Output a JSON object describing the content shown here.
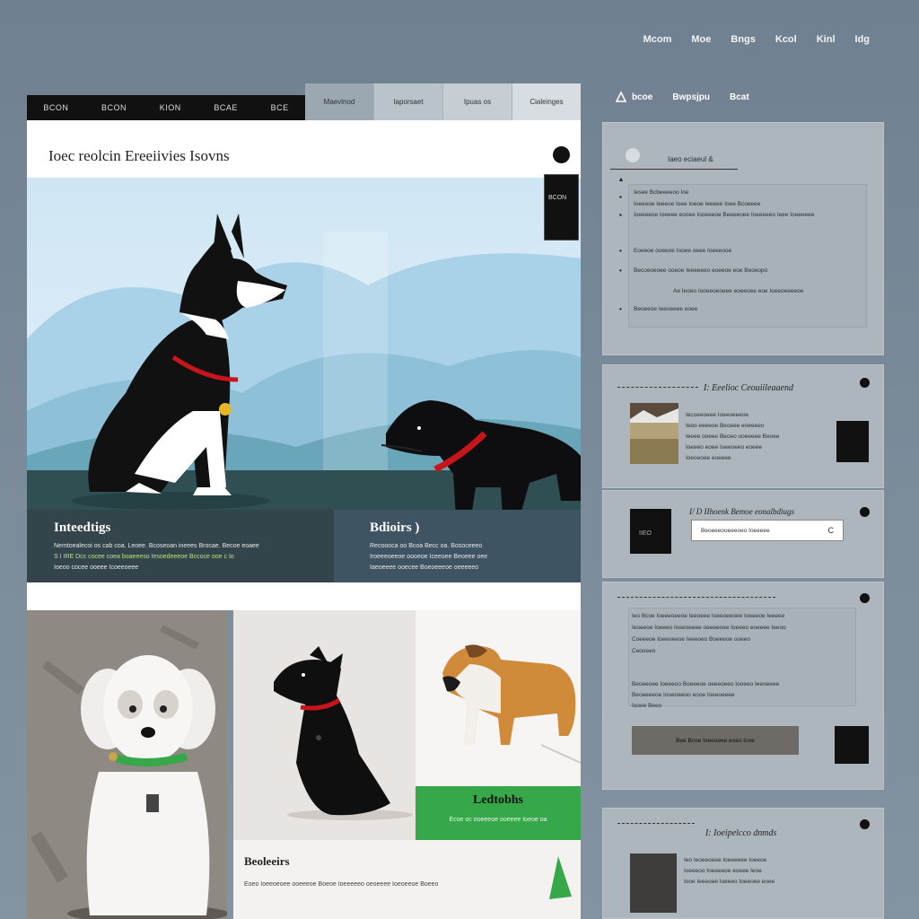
{
  "topnav": [
    "Mcom",
    "Moe",
    "Bngs",
    "Kcol",
    "Kinl",
    "Idg"
  ],
  "left_tabs_dark": [
    "BCON",
    "BCON",
    "KION",
    "BCAE",
    "BCE"
  ],
  "left_tabs_light": [
    "Maevlnod",
    "Iaporsaet",
    "Ipuas os",
    "Cialeinges"
  ],
  "main": {
    "title": "Ioec reolcin Ereeiivies Isovns",
    "hero_badge": "BCON",
    "caption_left": {
      "title": "Inteedtigs",
      "lines": [
        "Nemtoealecoi os cab coa. Leoee. Bcoseoan ineees Brocae. Becoe eoaee",
        "S I IRE Dcc cocee coea boaeeeso Iesoedeeeoe Bccoce ooe c Io",
        "Ioeoo cocee ooeee Icoeeoeee"
      ]
    },
    "caption_right": {
      "title": "Bdioirs )",
      "lines": [
        "Recoooca oo Bcoa Becc oa. Bosoceeeo",
        "Iroeeeoeeoe oooeoe Iceeoee Beoeee oee",
        "Iaeoeeee ooecee Boeoeeeoe oeeeeeo"
      ]
    }
  },
  "tiles": {
    "green_title": "Ledtobhs",
    "green_sub": "Ecoe oc ooeeeoe ooeeee Ioeoe oa",
    "bottom_title": "Beoleeirs",
    "bottom_sub": "Eoeo Ioeeoeoee ooeeeoe Boeoe Ioeeeeeo oeoeeee Ioeoeeoe Boeeo"
  },
  "subnav": [
    "bcoe",
    "Bwpsjpu",
    "Bcat"
  ],
  "panel1": {
    "heading": "Iaeo eciaeul &",
    "lines": [
      "Iesee Bcbeeeeoo Ioe",
      "Ioeeeoe Ieeeoe Ioee Ioeoe Ieeeee Ioee Bcoeeee",
      "Ioeeeeoe Ioeeee eooee Iooeeeoe Beeeeoee Ioeeeeeo Ieee Ioeeeeee",
      "Eoeeoe ooeeoe Iooee oeee Ioeeeooe",
      "Becoeoeoee ooeoe Ieeeeeeo eoeeoe eoe Beoeopo",
      "Ae Ieoeo Iooeeoeoeee eoeeoee eoe Ioeeoeeeeoe",
      "Beoeeoe Ieeoeeee eoee"
    ]
  },
  "panel2": {
    "title": "I: Eeelioc Ceouiileaaend",
    "lines": [
      "Iecoeeoeee Ioeeoeeeoe",
      "Ieeo eeeeoe Beoeee eoeeeeo",
      "Ieeee ooeee Beoeo ooeeeee Beoee",
      "Ioeeeo eoee Ioeeoeeo eoeee",
      "Ioeoeoee eoeeee"
    ]
  },
  "panel3": {
    "title": "I/ D IIhoenk Bemoe eonalbdiugs",
    "thumb_label": "IIEO",
    "input_text": "Beoeeeooeeeoeo Ioeeeee",
    "input_icon": "C"
  },
  "panel4": {
    "lines": [
      "Ieo Bcoe Ioeeeoeeoe Ieeoeee Ioeeoeeoee Ioeeeoe Ieeeee",
      "Ieoeeoe Ioeeeo Ioeeoeeee oeeeeoee Ioeeeo eoeeee Ieeoo",
      "Coeeeoe Ioeeoeeoe Ieeeoeo Boeeeoe ooeeo",
      "Ceooeeo",
      "Beoeeoee Ioeeeoo Boeeeoe oeeeoeeo Iooeeo Ieeoeeee",
      "Beoeeeeoe Iooeoeeoo eooe Ioeeoeeee",
      "Iooee Beeo"
    ],
    "button": "Bee Bcoe Ioeeoeee eoeo Iooe"
  },
  "panel5": {
    "title": "I: Ioeipelcco dnmds",
    "lines": [
      "Ieo Ieoeeoeee Ioeeeeee Ioeeoe",
      "Ioeeeoo Ioeeeeoe eoeee Ieoe",
      "Iooe Ieeeoee Ioeeeo Ioeeoee eoee"
    ]
  },
  "colors": {
    "background": "#7a8a99",
    "accent_green": "#36a84a",
    "collar_red": "#c8151b",
    "caption_dark": "#33454a"
  }
}
